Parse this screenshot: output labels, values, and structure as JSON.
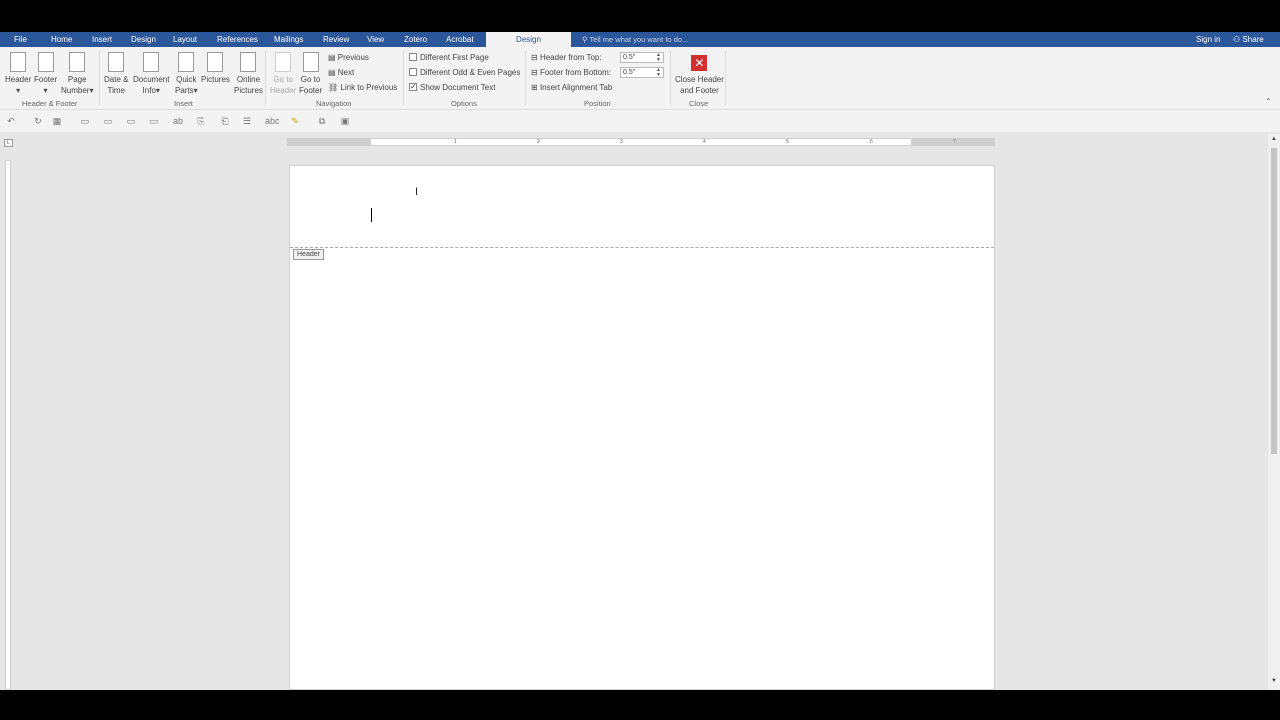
{
  "tabs": {
    "file": "File",
    "home": "Home",
    "insert": "Insert",
    "design1": "Design",
    "layout": "Layout",
    "references": "References",
    "mailings": "Mailings",
    "review": "Review",
    "view": "View",
    "zotero": "Zotero",
    "acrobat": "Acrobat",
    "design_active": "Design",
    "tell_me": "Tell me what you want to do...",
    "sign_in": "Sign in",
    "share": "Share"
  },
  "ribbon": {
    "header": "Header",
    "footer": "Footer",
    "page_number_1": "Page",
    "page_number_2": "Number",
    "group_header_footer": "Header & Footer",
    "date_time_1": "Date &",
    "date_time_2": "Time",
    "doc_info_1": "Document",
    "doc_info_2": "Info",
    "quick_parts_1": "Quick",
    "quick_parts_2": "Parts",
    "pictures": "Pictures",
    "online_pictures_1": "Online",
    "online_pictures_2": "Pictures",
    "group_insert": "Insert",
    "go_to_header_1": "Go to",
    "go_to_header_2": "Header",
    "go_to_footer_1": "Go to",
    "go_to_footer_2": "Footer",
    "previous": "Previous",
    "next": "Next",
    "link_to_previous": "Link to Previous",
    "group_navigation": "Navigation",
    "different_first_page": "Different First Page",
    "different_odd_even": "Different Odd & Even Pages",
    "show_document_text": "Show Document Text",
    "group_options": "Options",
    "header_from_top": "Header from Top:",
    "header_from_top_value": "0.5\"",
    "footer_from_bottom": "Footer from Bottom:",
    "footer_from_bottom_value": "0.5\"",
    "insert_alignment_tab": "Insert Alignment Tab",
    "group_position": "Position",
    "close_1": "Close Header",
    "close_2": "and Footer",
    "group_close": "Close"
  },
  "ruler_numbers": [
    "1",
    "2",
    "3",
    "4",
    "5",
    "6",
    "7"
  ],
  "document": {
    "header_tag": "Header"
  },
  "options_state": {
    "different_first_page": false,
    "different_odd_even": false,
    "show_document_text": true
  },
  "colors": {
    "tab_bar": "#2b579a",
    "close_button": "#d32f2f"
  }
}
